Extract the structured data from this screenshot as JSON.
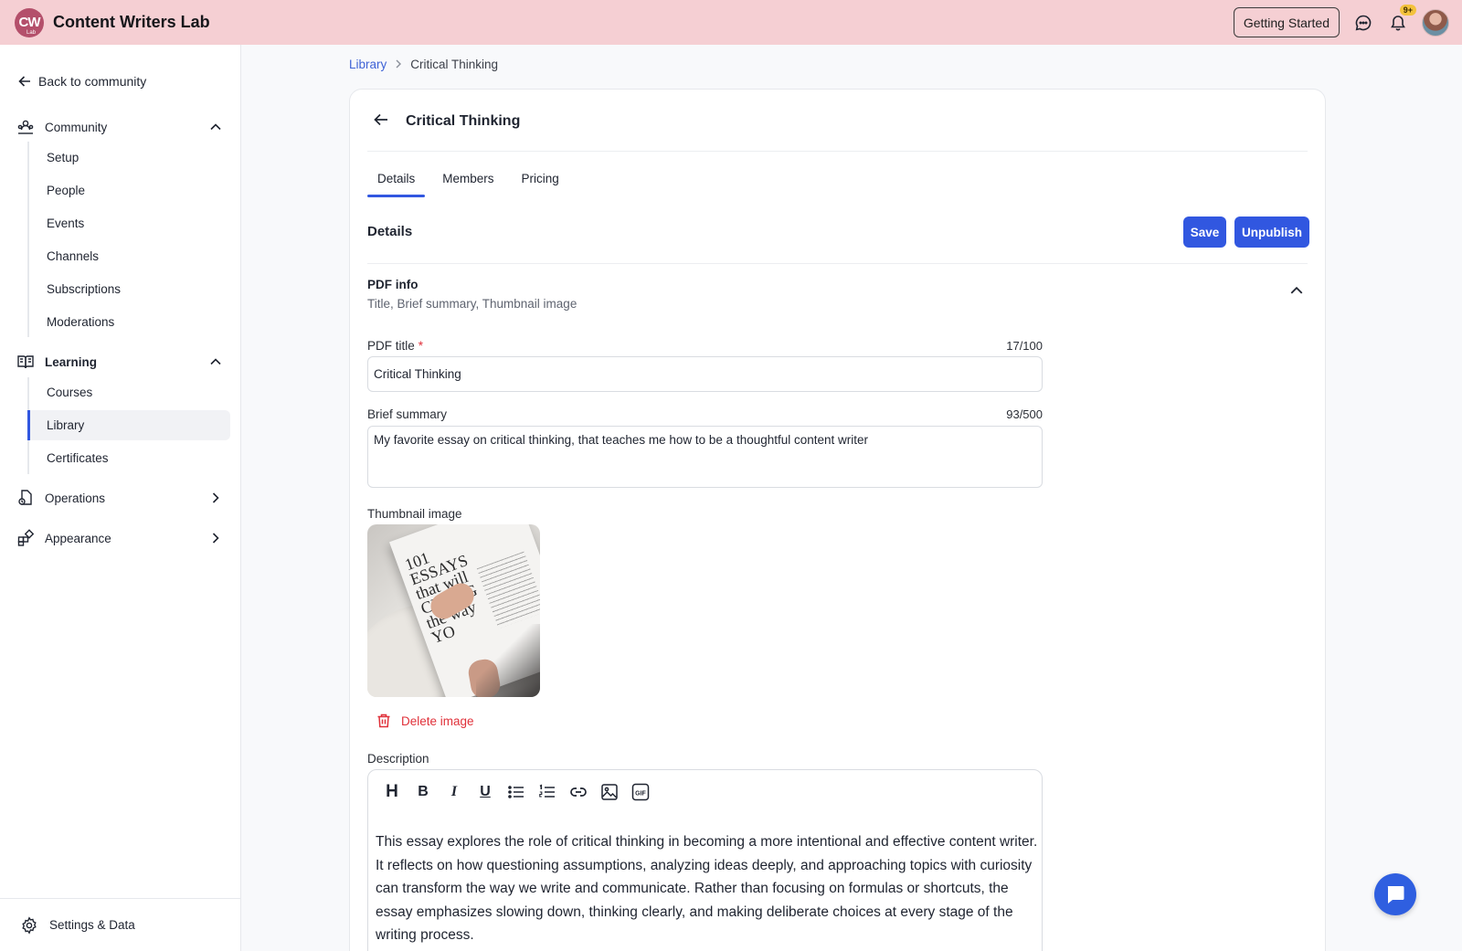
{
  "app": {
    "logo_text": "CW",
    "logo_sub": "Lab",
    "name": "Content Writers Lab",
    "getting_started_label": "Getting Started",
    "notifications_badge": "9+"
  },
  "sidebar": {
    "back_label": "Back to community",
    "sections": [
      {
        "label": "Community",
        "icon": "community-icon",
        "expanded": true,
        "items": [
          "Setup",
          "People",
          "Events",
          "Channels",
          "Subscriptions",
          "Moderations"
        ]
      },
      {
        "label": "Learning",
        "icon": "book-icon",
        "expanded": true,
        "items": [
          "Courses",
          "Library",
          "Certificates"
        ],
        "active_item": "Library"
      },
      {
        "label": "Operations",
        "icon": "operations-icon",
        "expanded": false
      },
      {
        "label": "Appearance",
        "icon": "appearance-icon",
        "expanded": false
      }
    ],
    "footer_label": "Settings & Data"
  },
  "breadcrumb": {
    "parent": "Library",
    "current": "Critical Thinking"
  },
  "page": {
    "title": "Critical Thinking",
    "tabs": [
      "Details",
      "Members",
      "Pricing"
    ],
    "active_tab": "Details",
    "section_heading": "Details",
    "save_label": "Save",
    "unpublish_label": "Unpublish"
  },
  "pdf_info": {
    "title": "PDF info",
    "subtitle": "Title, Brief summary, Thumbnail image",
    "pdf_title_label": "PDF title",
    "pdf_title_required": "*",
    "pdf_title_count": "17/100",
    "pdf_title_value": "Critical Thinking",
    "summary_label": "Brief summary",
    "summary_count": "93/500",
    "summary_value": "My favorite essay on critical thinking, that teaches me how to be a thoughtful content writer",
    "thumbnail_label": "Thumbnail image",
    "thumbnail_book_text": "101 ESSAYS that will CHANG the way YO",
    "delete_image_label": "Delete image"
  },
  "description": {
    "label": "Description",
    "toolbar": [
      "heading",
      "bold",
      "italic",
      "underline",
      "bullet-list",
      "numbered-list",
      "link",
      "image",
      "gif"
    ],
    "gif_label": "GIF",
    "body": "This essay explores the role of critical thinking in becoming a more intentional and effective content writer. It reflects on how questioning assumptions, analyzing ideas deeply, and approaching topics with curiosity can transform the way we write and communicate. Rather than focusing on formulas or shortcuts, the essay emphasizes slowing down, thinking clearly, and making deliberate choices at every stage of the writing process."
  },
  "colors": {
    "topbar": "#f5cfd3",
    "accent": "#3157e0",
    "danger": "#e0313a"
  }
}
